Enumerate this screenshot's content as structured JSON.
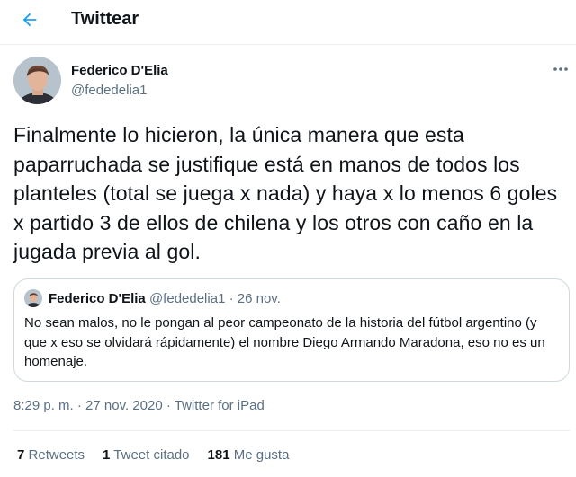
{
  "header": {
    "title": "Twittear",
    "back_icon": "arrow-left-icon",
    "accent_color": "#1da1f2"
  },
  "tweet": {
    "author_name": "Federico D'Elia",
    "author_handle": "@fededelia1",
    "more_icon": "more-horizontal-icon",
    "text": "Finalmente lo hicieron, la única manera que esta paparruchada se justifique está en manos de todos los planteles (total se juega x nada) y haya x lo menos 6 goles x partido 3 de ellos de chilena y los otros con caño en la jugada previa al gol.",
    "quote": {
      "author_name": "Federico D'Elia",
      "author_handle": "@fededelia1",
      "separator": "·",
      "date": "26 nov.",
      "text": "No sean malos, no le pongan al peor campeonato de la historia del fútbol argentino (y que x eso se olvidará rápidamente) el nombre Diego Armando Maradona, eso no es un homenaje."
    },
    "time": "8:29 p. m.",
    "separator": "·",
    "date": "27 nov. 2020",
    "source": "Twitter for iPad"
  },
  "stats": {
    "retweets_count": "7",
    "retweets_label": "Retweets",
    "quotes_count": "1",
    "quotes_label": "Tweet citado",
    "likes_count": "181",
    "likes_label": "Me gusta"
  }
}
